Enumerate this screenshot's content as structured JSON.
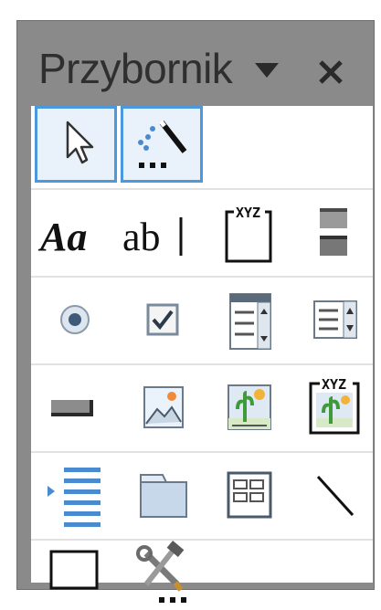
{
  "window": {
    "title": "Przybornik"
  },
  "tools": [
    {
      "row": 1,
      "items": [
        "pointer-tool",
        "control-wizards-tool"
      ]
    },
    {
      "row": 2,
      "items": [
        "label-tool",
        "textbox-tool",
        "option-group-tool",
        "toggle-button-tool"
      ]
    },
    {
      "row": 3,
      "items": [
        "option-button-tool",
        "checkbox-tool",
        "combo-box-tool",
        "list-box-tool"
      ]
    },
    {
      "row": 4,
      "items": [
        "command-button-tool",
        "image-tool",
        "unbound-object-frame-tool",
        "bound-object-frame-tool"
      ]
    },
    {
      "row": 5,
      "items": [
        "page-break-tool",
        "tab-control-tool",
        "subform-tool",
        "line-tool"
      ]
    },
    {
      "row": 6,
      "items": [
        "rectangle-tool",
        "more-controls-tool"
      ]
    }
  ],
  "colors": {
    "titlebar": "#8a8a8a",
    "selection": "#4b98dc",
    "panel": "#ffffff"
  }
}
